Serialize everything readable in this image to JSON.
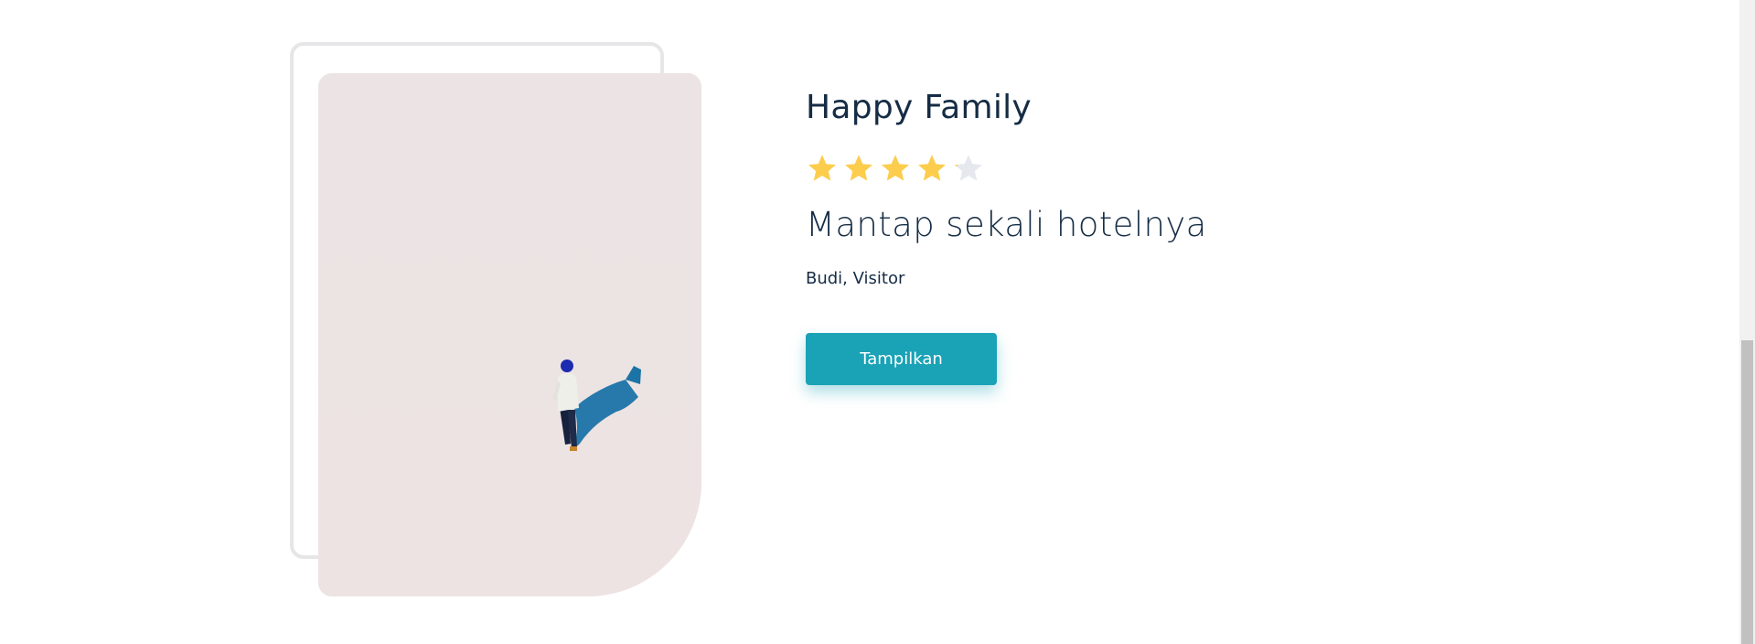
{
  "testimonial": {
    "title": "Happy Family",
    "rating": 4.5,
    "rating_max": 5,
    "message": "Mantap sekali hotelnya",
    "author": "Budi, Visitor",
    "button_label": "Tampilkan"
  },
  "colors": {
    "star_filled": "#fccd4d",
    "star_empty": "#e5e9ee",
    "button": "#1aa2b6",
    "text": "#152c44"
  },
  "image": {
    "description": "person-walking-on-white-surface"
  }
}
